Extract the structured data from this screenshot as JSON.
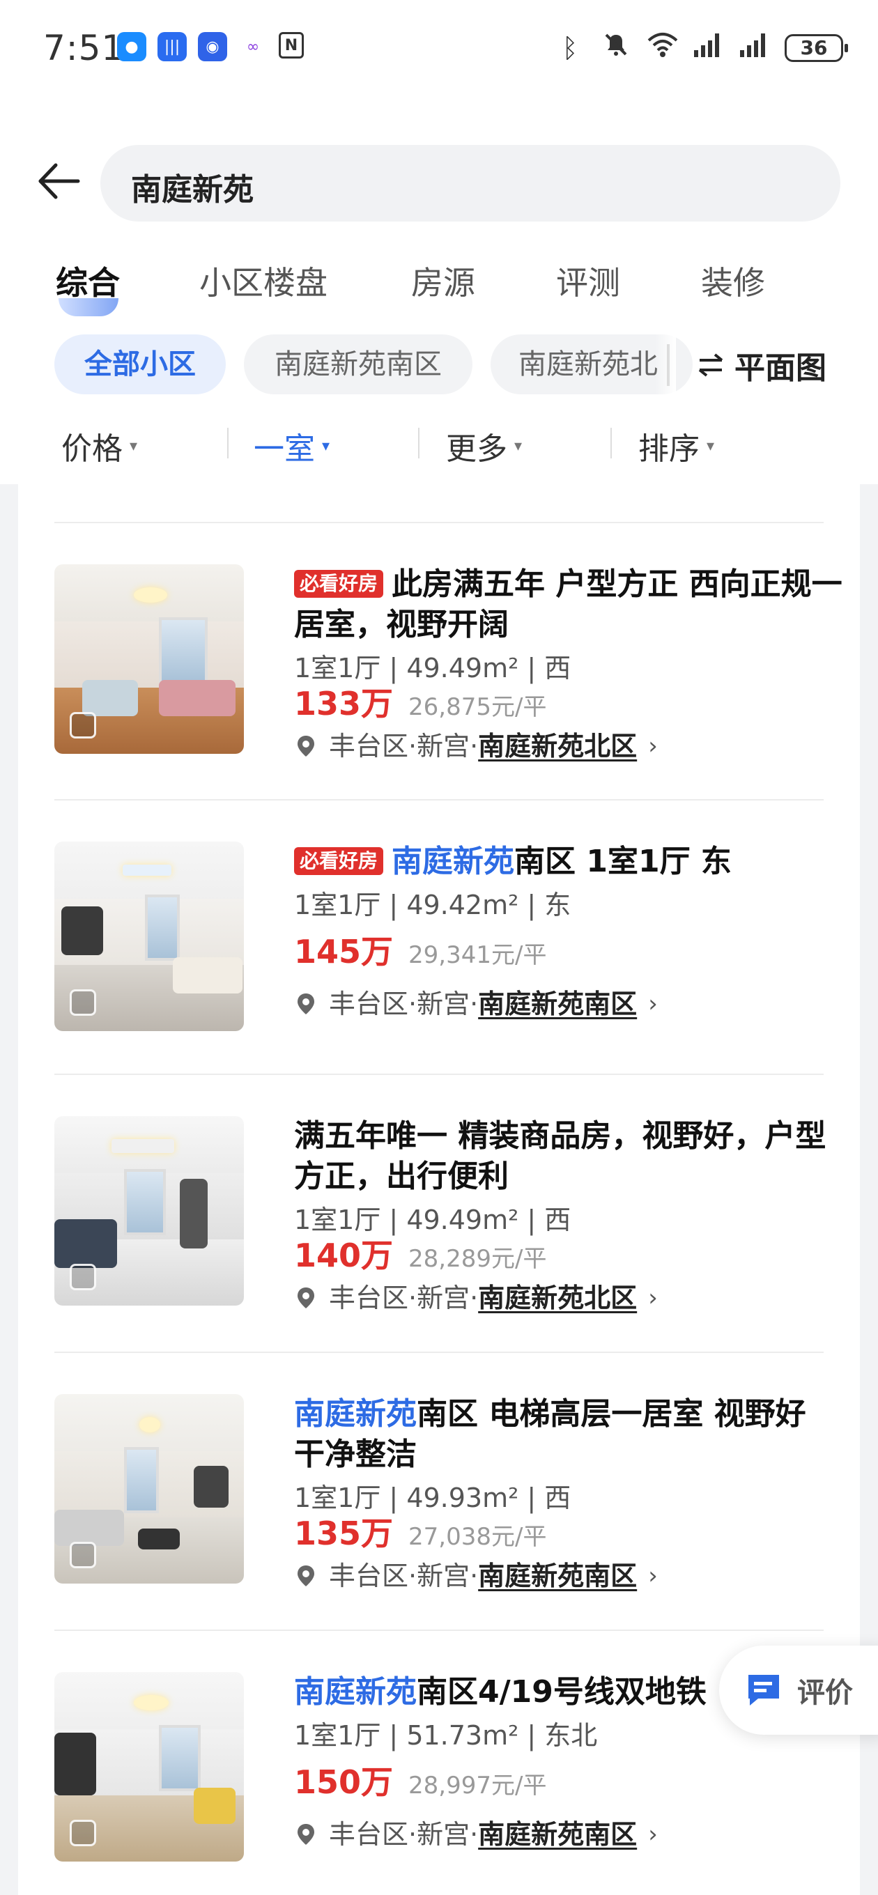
{
  "status_bar": {
    "time": "7:51",
    "battery": "36",
    "app_icons": [
      "message-app-icon",
      "voice-app-icon",
      "shield-app-icon",
      "infinity-app-icon",
      "nfc-icon"
    ],
    "system_icons": [
      "bluetooth-icon",
      "mute-icon",
      "wifi-icon",
      "signal-icon-1",
      "signal-icon-2"
    ]
  },
  "search": {
    "query": "南庭新苑"
  },
  "tabs": [
    {
      "label": "综合",
      "active": true
    },
    {
      "label": "小区楼盘"
    },
    {
      "label": "房源"
    },
    {
      "label": "评测"
    },
    {
      "label": "装修"
    }
  ],
  "chips": [
    {
      "label": "全部小区",
      "active": true
    },
    {
      "label": "南庭新苑南区"
    },
    {
      "label": "南庭新苑北"
    }
  ],
  "floorplan_label": "平面图",
  "filters": [
    {
      "label": "价格"
    },
    {
      "label": "一室",
      "active": true
    },
    {
      "label": "更多"
    },
    {
      "label": "排序"
    }
  ],
  "listings": [
    {
      "tag": "必看好房",
      "title_highlight": "",
      "title": "此房满五年 户型方正 西向正规一居室，视野开阔",
      "meta": "1室1厅 | 49.49m² | 西",
      "price": "133万",
      "unit_price": "26,875元/平",
      "district": "丰台区·新宫·",
      "community": "南庭新苑北区"
    },
    {
      "tag": "必看好房",
      "title_highlight": "南庭新苑",
      "title": "南区 1室1厅 东",
      "meta": "1室1厅 | 49.42m² | 东",
      "price": "145万",
      "unit_price": "29,341元/平",
      "district": "丰台区·新宫·",
      "community": "南庭新苑南区"
    },
    {
      "tag": "",
      "title_highlight": "",
      "title": "满五年唯一 精装商品房，视野好，户型方正，出行便利",
      "meta": "1室1厅 | 49.49m² | 西",
      "price": "140万",
      "unit_price": "28,289元/平",
      "district": "丰台区·新宫·",
      "community": "南庭新苑北区"
    },
    {
      "tag": "",
      "title_highlight": "南庭新苑",
      "title": "南区  电梯高层一居室 视野好 干净整洁",
      "meta": "1室1厅 | 49.93m² | 西",
      "price": "135万",
      "unit_price": "27,038元/平",
      "district": "丰台区·新宫·",
      "community": "南庭新苑南区"
    },
    {
      "tag": "",
      "title_highlight": "南庭新苑",
      "title": "南区4/19号线双地铁",
      "meta": "1室1厅 | 51.73m² | 东北",
      "price": "150万",
      "unit_price": "28,997元/平",
      "district": "丰台区·新宫·",
      "community": "南庭新苑南区"
    }
  ],
  "review_button": {
    "label": "评价"
  },
  "colors": {
    "accent": "#2d6be4",
    "price": "#e0302c",
    "tag": "#e0302c"
  }
}
